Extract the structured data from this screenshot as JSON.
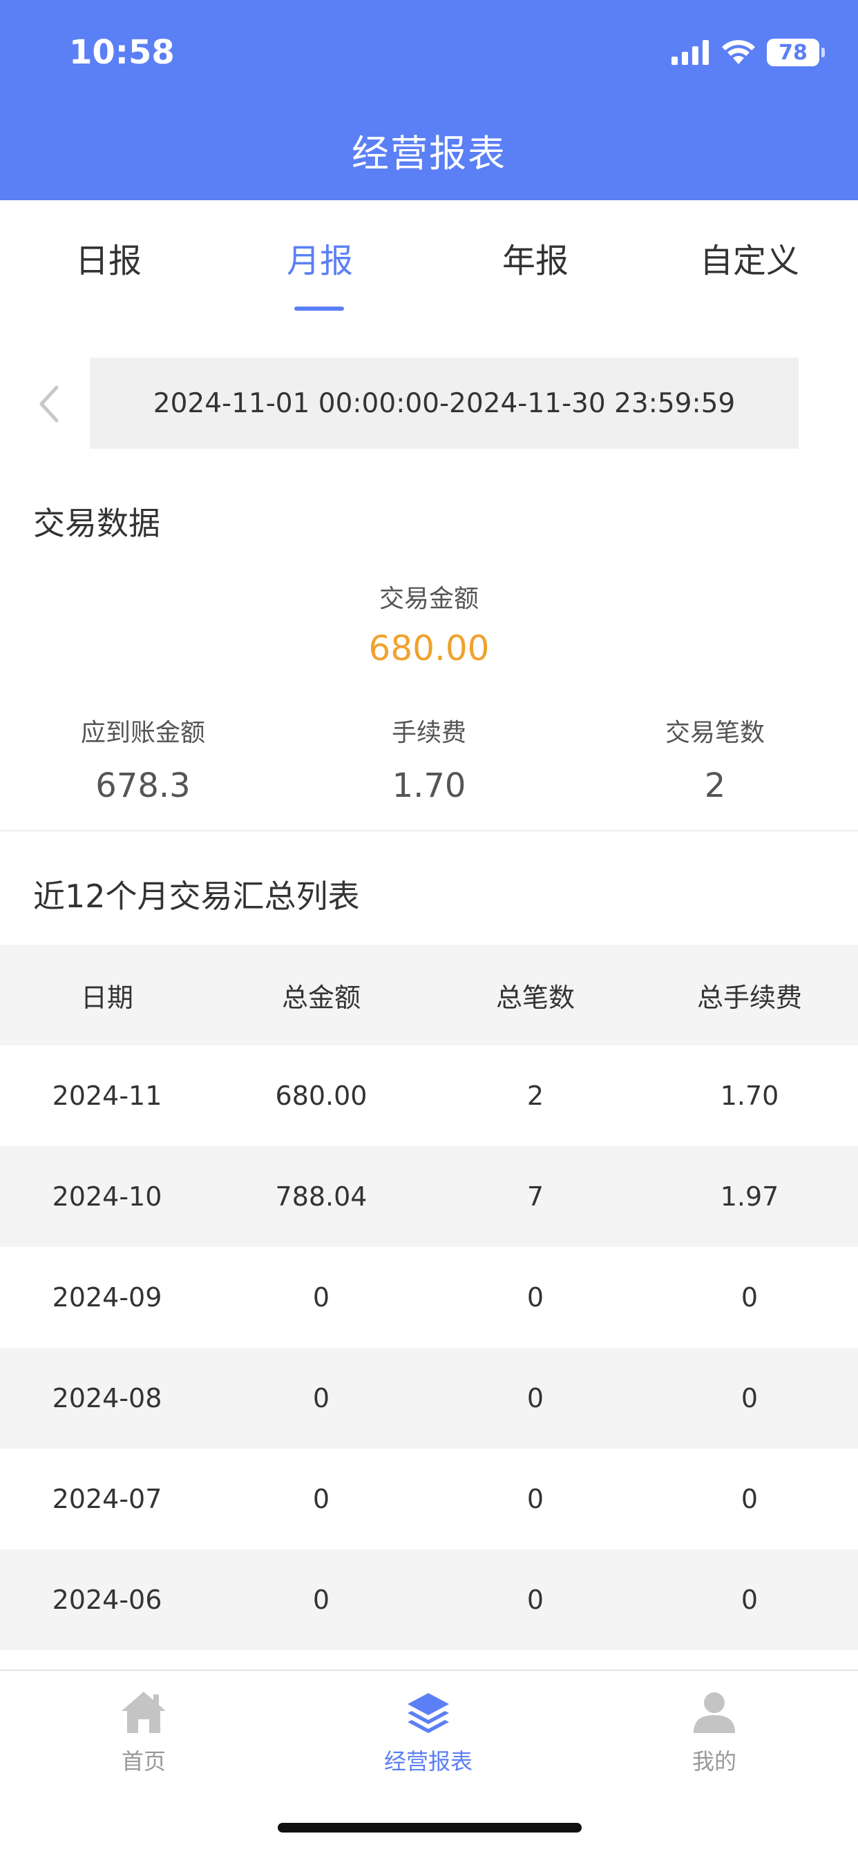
{
  "status_bar": {
    "time": "10:58",
    "battery": "78"
  },
  "header": {
    "title": "经营报表"
  },
  "tabs": [
    {
      "label": "日报"
    },
    {
      "label": "月报"
    },
    {
      "label": "年报"
    },
    {
      "label": "自定义"
    }
  ],
  "active_tab": "月报",
  "date_range": "2024-11-01 00:00:00-2024-11-30 23:59:59",
  "transaction": {
    "section_title": "交易数据",
    "amount_label": "交易金额",
    "amount_value": "680.00",
    "stats": [
      {
        "label": "应到账金额",
        "value": "678.3"
      },
      {
        "label": "手续费",
        "value": "1.70"
      },
      {
        "label": "交易笔数",
        "value": "2"
      }
    ]
  },
  "summary": {
    "section_title": "近12个月交易汇总列表",
    "columns": [
      "日期",
      "总金额",
      "总笔数",
      "总手续费"
    ],
    "rows": [
      [
        "2024-11",
        "680.00",
        "2",
        "1.70"
      ],
      [
        "2024-10",
        "788.04",
        "7",
        "1.97"
      ],
      [
        "2024-09",
        "0",
        "0",
        "0"
      ],
      [
        "2024-08",
        "0",
        "0",
        "0"
      ],
      [
        "2024-07",
        "0",
        "0",
        "0"
      ],
      [
        "2024-06",
        "0",
        "0",
        "0"
      ]
    ]
  },
  "bottom_nav": [
    {
      "label": "首页",
      "icon": "home-icon"
    },
    {
      "label": "经营报表",
      "icon": "layers-icon"
    },
    {
      "label": "我的",
      "icon": "user-icon"
    }
  ],
  "colors": {
    "accent": "#5b7ff5",
    "amount": "#f0a22e",
    "inactive": "#999999"
  }
}
